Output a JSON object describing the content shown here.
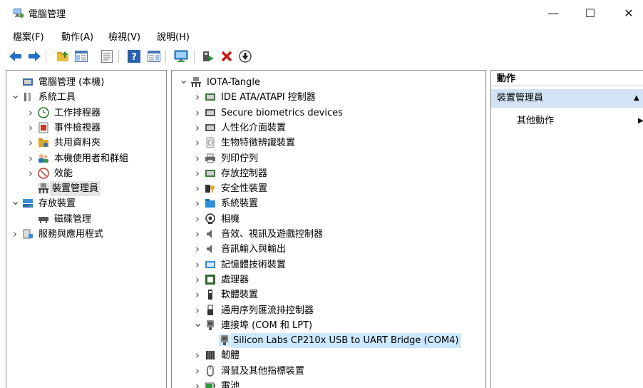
{
  "window": {
    "title": "電腦管理",
    "min_glyph": "—",
    "max_glyph": "☐",
    "close_glyph": "✕"
  },
  "menu": [
    "檔案(F)",
    "動作(A)",
    "檢視(V)",
    "說明(H)"
  ],
  "toolbar": [
    "back-icon",
    "forward-icon",
    "up-folder-icon",
    "show-tree-icon",
    "properties-icon",
    "help-icon",
    "show-action-pane-icon",
    "monitor-icon",
    "update-driver-icon",
    "uninstall-icon",
    "scan-hardware-icon"
  ],
  "left_tree": [
    {
      "label": "電腦管理 (本機)",
      "level": 0,
      "chev": "",
      "icon": "computer-management-icon"
    },
    {
      "label": "系統工具",
      "level": 0,
      "chev": "v",
      "icon": "tools-icon"
    },
    {
      "label": "工作排程器",
      "level": 1,
      "chev": ">",
      "icon": "clock-icon"
    },
    {
      "label": "事件檢視器",
      "level": 1,
      "chev": ">",
      "icon": "event-viewer-icon"
    },
    {
      "label": "共用資料夾",
      "level": 1,
      "chev": ">",
      "icon": "shared-folder-icon"
    },
    {
      "label": "本機使用者和群組",
      "level": 1,
      "chev": ">",
      "icon": "users-icon"
    },
    {
      "label": "效能",
      "level": 1,
      "chev": ">",
      "icon": "performance-icon"
    },
    {
      "label": "裝置管理員",
      "level": 1,
      "chev": "",
      "icon": "device-manager-icon",
      "selected": true
    },
    {
      "label": "存放裝置",
      "level": 0,
      "chev": "v",
      "icon": "storage-icon"
    },
    {
      "label": "磁碟管理",
      "level": 1,
      "chev": "",
      "icon": "disk-icon"
    },
    {
      "label": "服務與應用程式",
      "level": 0,
      "chev": ">",
      "icon": "services-icon"
    }
  ],
  "device_tree": [
    {
      "label": "IOTA-Tangle",
      "level": 0,
      "chev": "v",
      "icon": "computer-icon"
    },
    {
      "label": "IDE ATA/ATAPI 控制器",
      "level": 1,
      "chev": ">",
      "icon": "ide-controller-icon"
    },
    {
      "label": "Secure biometrics devices",
      "level": 1,
      "chev": ">",
      "icon": "biometric-icon"
    },
    {
      "label": "人性化介面裝置",
      "level": 1,
      "chev": ">",
      "icon": "hid-icon"
    },
    {
      "label": "生物特徵辨識裝置",
      "level": 1,
      "chev": ">",
      "icon": "fingerprint-icon"
    },
    {
      "label": "列印佇列",
      "level": 1,
      "chev": ">",
      "icon": "printer-icon"
    },
    {
      "label": "存放控制器",
      "level": 1,
      "chev": ">",
      "icon": "storage-controller-icon"
    },
    {
      "label": "安全性裝置",
      "level": 1,
      "chev": ">",
      "icon": "security-device-icon"
    },
    {
      "label": "系統裝置",
      "level": 1,
      "chev": ">",
      "icon": "system-device-icon"
    },
    {
      "label": "相機",
      "level": 1,
      "chev": ">",
      "icon": "camera-icon"
    },
    {
      "label": "音效、視訊及遊戲控制器",
      "level": 1,
      "chev": ">",
      "icon": "sound-icon"
    },
    {
      "label": "音訊輸入與輸出",
      "level": 1,
      "chev": ">",
      "icon": "audio-io-icon"
    },
    {
      "label": "記憶體技術裝置",
      "level": 1,
      "chev": ">",
      "icon": "memory-icon"
    },
    {
      "label": "處理器",
      "level": 1,
      "chev": ">",
      "icon": "processor-icon"
    },
    {
      "label": "軟體裝置",
      "level": 1,
      "chev": ">",
      "icon": "software-device-icon"
    },
    {
      "label": "通用序列匯流排控制器",
      "level": 1,
      "chev": ">",
      "icon": "usb-icon"
    },
    {
      "label": "連接埠 (COM 和 LPT)",
      "level": 1,
      "chev": "v",
      "icon": "port-icon"
    },
    {
      "label": "Silicon Labs CP210x USB to UART Bridge (COM4)",
      "level": 2,
      "chev": "",
      "icon": "port-icon",
      "selected": true
    },
    {
      "label": "韌體",
      "level": 1,
      "chev": ">",
      "icon": "firmware-icon"
    },
    {
      "label": "滑鼠及其他指標裝置",
      "level": 1,
      "chev": ">",
      "icon": "mouse-icon"
    },
    {
      "label": "電池",
      "level": 1,
      "chev": ">",
      "icon": "battery-icon"
    }
  ],
  "actions": {
    "header": "動作",
    "group": "裝置管理員",
    "group_arrow": "▲",
    "item": "其他動作",
    "item_arrow": "▶"
  },
  "colors": {
    "selected_left": "#e5e5e5",
    "selected_right": "#cce8ff",
    "action_group": "#d3e3f5"
  }
}
